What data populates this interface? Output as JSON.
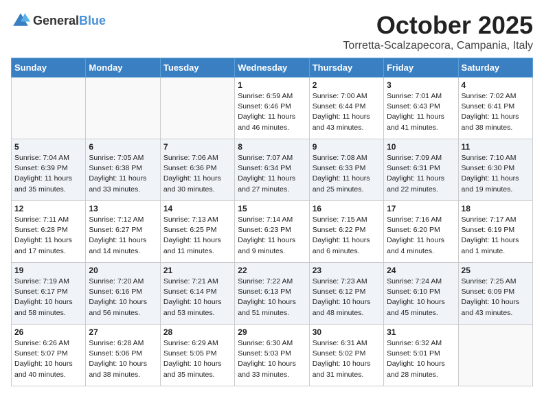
{
  "header": {
    "logo_general": "General",
    "logo_blue": "Blue",
    "month": "October 2025",
    "location": "Torretta-Scalzapecora, Campania, Italy"
  },
  "days_of_week": [
    "Sunday",
    "Monday",
    "Tuesday",
    "Wednesday",
    "Thursday",
    "Friday",
    "Saturday"
  ],
  "weeks": [
    [
      {
        "day": "",
        "info": ""
      },
      {
        "day": "",
        "info": ""
      },
      {
        "day": "",
        "info": ""
      },
      {
        "day": "1",
        "info": "Sunrise: 6:59 AM\nSunset: 6:46 PM\nDaylight: 11 hours\nand 46 minutes."
      },
      {
        "day": "2",
        "info": "Sunrise: 7:00 AM\nSunset: 6:44 PM\nDaylight: 11 hours\nand 43 minutes."
      },
      {
        "day": "3",
        "info": "Sunrise: 7:01 AM\nSunset: 6:43 PM\nDaylight: 11 hours\nand 41 minutes."
      },
      {
        "day": "4",
        "info": "Sunrise: 7:02 AM\nSunset: 6:41 PM\nDaylight: 11 hours\nand 38 minutes."
      }
    ],
    [
      {
        "day": "5",
        "info": "Sunrise: 7:04 AM\nSunset: 6:39 PM\nDaylight: 11 hours\nand 35 minutes."
      },
      {
        "day": "6",
        "info": "Sunrise: 7:05 AM\nSunset: 6:38 PM\nDaylight: 11 hours\nand 33 minutes."
      },
      {
        "day": "7",
        "info": "Sunrise: 7:06 AM\nSunset: 6:36 PM\nDaylight: 11 hours\nand 30 minutes."
      },
      {
        "day": "8",
        "info": "Sunrise: 7:07 AM\nSunset: 6:34 PM\nDaylight: 11 hours\nand 27 minutes."
      },
      {
        "day": "9",
        "info": "Sunrise: 7:08 AM\nSunset: 6:33 PM\nDaylight: 11 hours\nand 25 minutes."
      },
      {
        "day": "10",
        "info": "Sunrise: 7:09 AM\nSunset: 6:31 PM\nDaylight: 11 hours\nand 22 minutes."
      },
      {
        "day": "11",
        "info": "Sunrise: 7:10 AM\nSunset: 6:30 PM\nDaylight: 11 hours\nand 19 minutes."
      }
    ],
    [
      {
        "day": "12",
        "info": "Sunrise: 7:11 AM\nSunset: 6:28 PM\nDaylight: 11 hours\nand 17 minutes."
      },
      {
        "day": "13",
        "info": "Sunrise: 7:12 AM\nSunset: 6:27 PM\nDaylight: 11 hours\nand 14 minutes."
      },
      {
        "day": "14",
        "info": "Sunrise: 7:13 AM\nSunset: 6:25 PM\nDaylight: 11 hours\nand 11 minutes."
      },
      {
        "day": "15",
        "info": "Sunrise: 7:14 AM\nSunset: 6:23 PM\nDaylight: 11 hours\nand 9 minutes."
      },
      {
        "day": "16",
        "info": "Sunrise: 7:15 AM\nSunset: 6:22 PM\nDaylight: 11 hours\nand 6 minutes."
      },
      {
        "day": "17",
        "info": "Sunrise: 7:16 AM\nSunset: 6:20 PM\nDaylight: 11 hours\nand 4 minutes."
      },
      {
        "day": "18",
        "info": "Sunrise: 7:17 AM\nSunset: 6:19 PM\nDaylight: 11 hours\nand 1 minute."
      }
    ],
    [
      {
        "day": "19",
        "info": "Sunrise: 7:19 AM\nSunset: 6:17 PM\nDaylight: 10 hours\nand 58 minutes."
      },
      {
        "day": "20",
        "info": "Sunrise: 7:20 AM\nSunset: 6:16 PM\nDaylight: 10 hours\nand 56 minutes."
      },
      {
        "day": "21",
        "info": "Sunrise: 7:21 AM\nSunset: 6:14 PM\nDaylight: 10 hours\nand 53 minutes."
      },
      {
        "day": "22",
        "info": "Sunrise: 7:22 AM\nSunset: 6:13 PM\nDaylight: 10 hours\nand 51 minutes."
      },
      {
        "day": "23",
        "info": "Sunrise: 7:23 AM\nSunset: 6:12 PM\nDaylight: 10 hours\nand 48 minutes."
      },
      {
        "day": "24",
        "info": "Sunrise: 7:24 AM\nSunset: 6:10 PM\nDaylight: 10 hours\nand 45 minutes."
      },
      {
        "day": "25",
        "info": "Sunrise: 7:25 AM\nSunset: 6:09 PM\nDaylight: 10 hours\nand 43 minutes."
      }
    ],
    [
      {
        "day": "26",
        "info": "Sunrise: 6:26 AM\nSunset: 5:07 PM\nDaylight: 10 hours\nand 40 minutes."
      },
      {
        "day": "27",
        "info": "Sunrise: 6:28 AM\nSunset: 5:06 PM\nDaylight: 10 hours\nand 38 minutes."
      },
      {
        "day": "28",
        "info": "Sunrise: 6:29 AM\nSunset: 5:05 PM\nDaylight: 10 hours\nand 35 minutes."
      },
      {
        "day": "29",
        "info": "Sunrise: 6:30 AM\nSunset: 5:03 PM\nDaylight: 10 hours\nand 33 minutes."
      },
      {
        "day": "30",
        "info": "Sunrise: 6:31 AM\nSunset: 5:02 PM\nDaylight: 10 hours\nand 31 minutes."
      },
      {
        "day": "31",
        "info": "Sunrise: 6:32 AM\nSunset: 5:01 PM\nDaylight: 10 hours\nand 28 minutes."
      },
      {
        "day": "",
        "info": ""
      }
    ]
  ]
}
